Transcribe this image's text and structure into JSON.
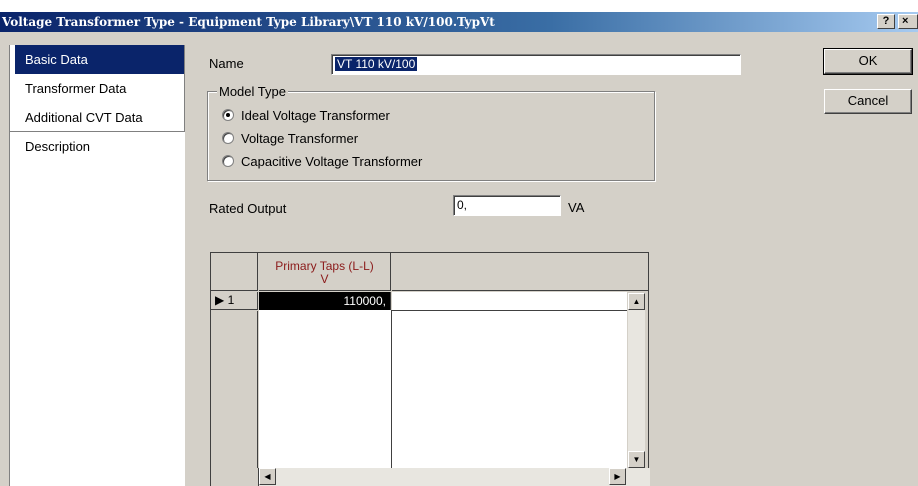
{
  "window": {
    "title": "Voltage Transformer Type - Equipment Type Library\\VT 110 kV/100.TypVt",
    "help_label": "?",
    "close_label": "×"
  },
  "nav": {
    "items": [
      {
        "label": "Basic Data",
        "active": true
      },
      {
        "label": "Transformer Data"
      },
      {
        "label": "Additional CVT Data"
      },
      {
        "label": "Description"
      }
    ]
  },
  "form": {
    "name_label": "Name",
    "name_value": "VT 110 kV/100",
    "model_type": {
      "title": "Model Type",
      "options": [
        {
          "label": "Ideal Voltage Transformer",
          "selected": true
        },
        {
          "label": "Voltage Transformer",
          "selected": false
        },
        {
          "label": "Capacitive Voltage Transformer",
          "selected": false
        }
      ]
    },
    "rated_output_label": "Rated Output",
    "rated_output_value": "0,",
    "rated_output_unit": "VA"
  },
  "buttons": {
    "ok": "OK",
    "cancel": "Cancel"
  },
  "table": {
    "column_header_line1": "Primary Taps (L-L)",
    "column_header_line2": "V",
    "rows": [
      {
        "row_marker": "▶ 1",
        "primary_taps": "110000,"
      }
    ]
  },
  "colors": {
    "selection": "#0a246a",
    "column_header_text": "#8b1a1a",
    "dialog_face": "#d4d0c8"
  }
}
